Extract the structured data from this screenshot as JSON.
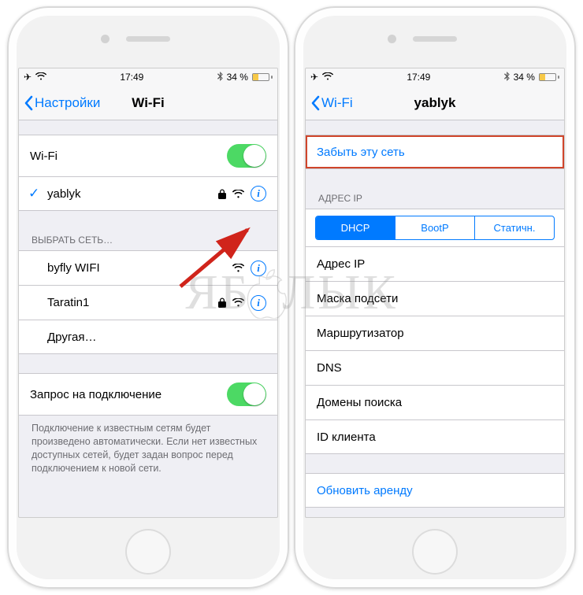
{
  "statusbar": {
    "time": "17:49",
    "battery_text": "34 %",
    "battery_pct": 34
  },
  "left": {
    "back_label": "Настройки",
    "title": "Wi-Fi",
    "wifi_toggle_label": "Wi-Fi",
    "connected_network": "yablyk",
    "choose_network_header": "ВЫБРАТЬ СЕТЬ…",
    "networks": [
      {
        "ssid": "byfly WIFI",
        "locked": false
      },
      {
        "ssid": "Taratin1",
        "locked": true
      }
    ],
    "other_label": "Другая…",
    "ask_to_join_label": "Запрос на подключение",
    "ask_to_join_footer": "Подключение к известным сетям будет произведено автоматически. Если нет известных доступных сетей, будет задан вопрос перед подключением к новой сети."
  },
  "right": {
    "back_label": "Wi-Fi",
    "title": "yablyk",
    "forget_label": "Забыть эту сеть",
    "ip_header": "АДРЕС IP",
    "seg": {
      "dhcp": "DHCP",
      "bootp": "BootP",
      "static": "Статичн."
    },
    "rows": {
      "ip": "Адрес IP",
      "subnet": "Маска подсети",
      "router": "Маршрутизатор",
      "dns": "DNS",
      "search": "Домены поиска",
      "client": "ID клиента"
    },
    "renew_label": "Обновить аренду"
  },
  "watermark": {
    "left": "ЯБ",
    "right": "ЛЫК"
  }
}
